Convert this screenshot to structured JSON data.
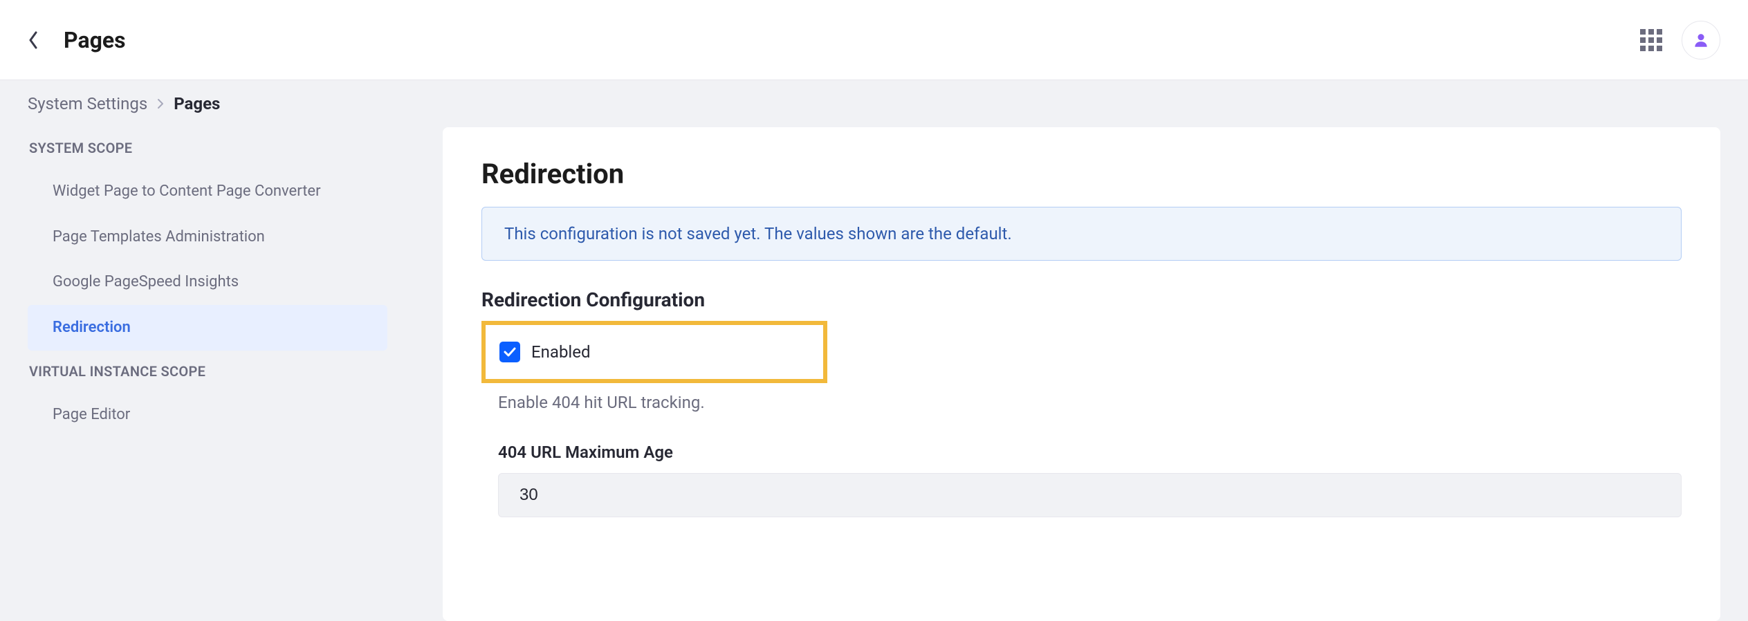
{
  "header": {
    "title": "Pages"
  },
  "breadcrumb": {
    "parent": "System Settings",
    "current": "Pages"
  },
  "sidebar": {
    "scopes": [
      {
        "heading": "SYSTEM SCOPE",
        "items": [
          {
            "label": "Widget Page to Content Page Converter",
            "name": "nav-widget-page-converter",
            "active": false
          },
          {
            "label": "Page Templates Administration",
            "name": "nav-page-templates-admin",
            "active": false
          },
          {
            "label": "Google PageSpeed Insights",
            "name": "nav-google-pagespeed",
            "active": false
          },
          {
            "label": "Redirection",
            "name": "nav-redirection",
            "active": true
          }
        ]
      },
      {
        "heading": "VIRTUAL INSTANCE SCOPE",
        "items": [
          {
            "label": "Page Editor",
            "name": "nav-page-editor",
            "active": false
          }
        ]
      }
    ]
  },
  "panel": {
    "title": "Redirection",
    "banner": "This configuration is not saved yet. The values shown are the default.",
    "section_heading": "Redirection Configuration",
    "enabled": {
      "label": "Enabled",
      "checked": true,
      "help": "Enable 404 hit URL tracking."
    },
    "maxAge": {
      "label": "404 URL Maximum Age",
      "value": "30"
    }
  }
}
